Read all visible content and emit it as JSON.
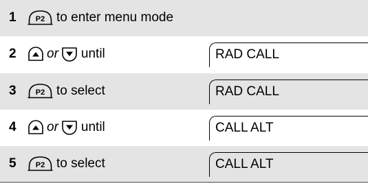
{
  "steps": [
    {
      "number": "1",
      "key_label": "P2",
      "action": "to enter menu mode"
    },
    {
      "number": "2",
      "connector": "or",
      "action": "until",
      "display": "RAD CALL"
    },
    {
      "number": "3",
      "key_label": "P2",
      "action": "to select",
      "display": "RAD CALL"
    },
    {
      "number": "4",
      "connector": "or",
      "action": "until",
      "display": "CALL ALT"
    },
    {
      "number": "5",
      "key_label": "P2",
      "action": "to select",
      "display": "CALL ALT"
    }
  ],
  "icons": {
    "program_key": "p2-key-icon",
    "up": "scroll-up-key-icon",
    "down": "scroll-down-key-icon"
  },
  "colors": {
    "shaded_row": "#e4e4e4",
    "separator": "#9a9a9a"
  }
}
